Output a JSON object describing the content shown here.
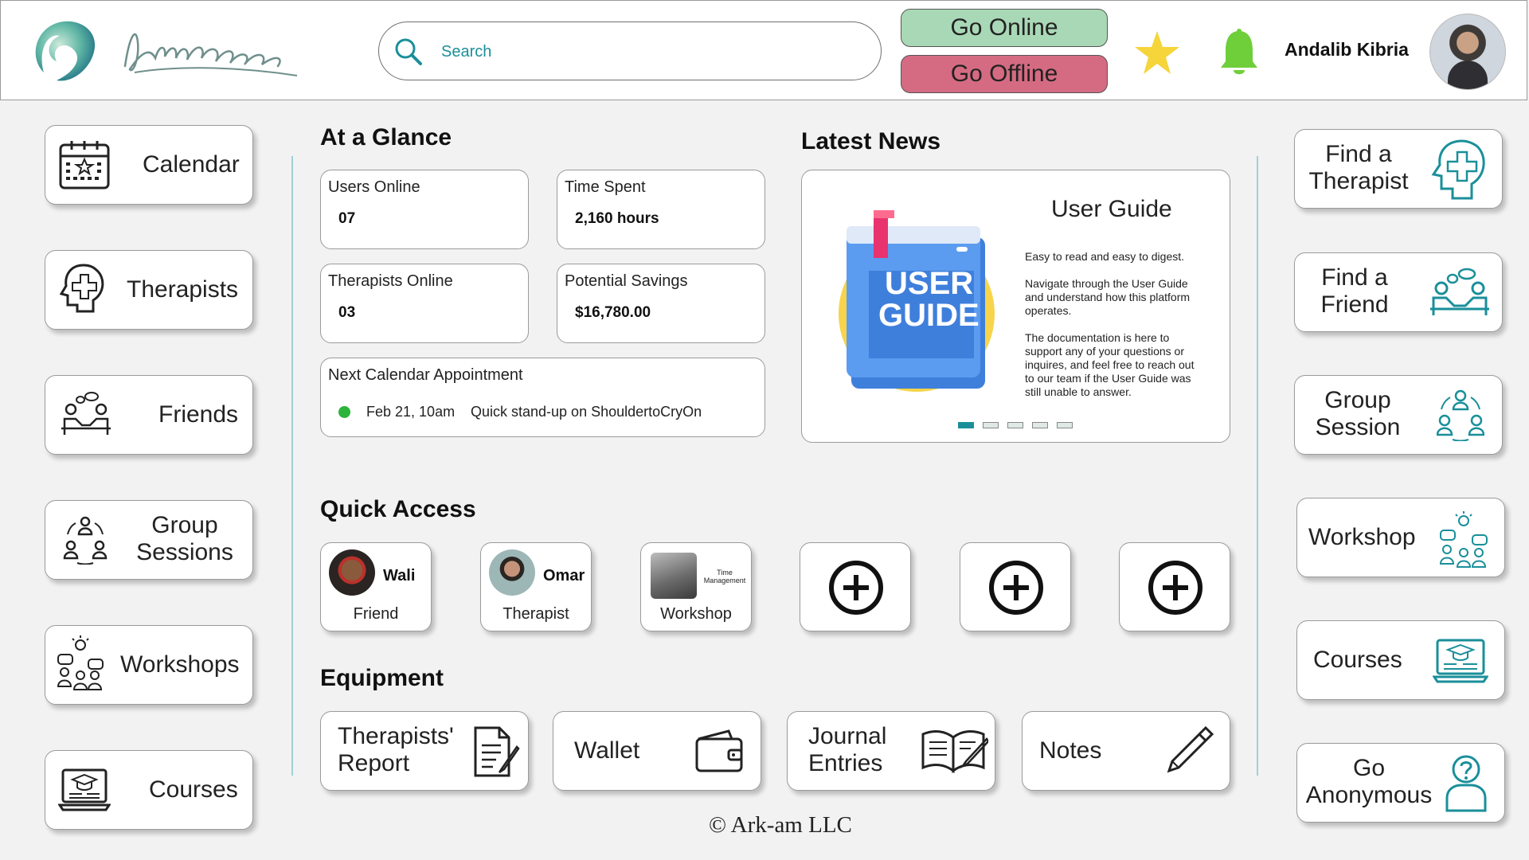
{
  "header": {
    "search_placeholder": "Search",
    "go_online": "Go Online",
    "go_offline": "Go Offline",
    "user_name": "Andalib Kibria"
  },
  "left_nav": [
    {
      "label": "Calendar",
      "icon": "calendar-icon"
    },
    {
      "label": "Therapists",
      "icon": "therapist-head-icon"
    },
    {
      "label": "Friends",
      "icon": "friends-icon"
    },
    {
      "label": "Group Sessions",
      "icon": "group-session-icon"
    },
    {
      "label": "Workshops",
      "icon": "workshop-icon"
    },
    {
      "label": "Courses",
      "icon": "courses-icon"
    }
  ],
  "glance": {
    "title": "At a Glance",
    "users_online_label": "Users Online",
    "users_online_value": "07",
    "time_spent_label": "Time Spent",
    "time_spent_value": "2,160 hours",
    "therapists_online_label": "Therapists Online",
    "therapists_online_value": "03",
    "savings_label": "Potential Savings",
    "savings_value": "$16,780.00",
    "appointment_label": "Next Calendar Appointment",
    "appointment_date": "Feb 21, 10am",
    "appointment_text": "Quick stand-up on ShouldertoCryOn"
  },
  "news": {
    "title": "Latest News",
    "card_title": "User Guide",
    "book_line1": "USER",
    "book_line2": "GUIDE",
    "p1": "Easy to read and easy to digest.",
    "p2": "Navigate through the User Guide and understand how this platform operates.",
    "p3": "The documentation is here to support any of your questions or inquires, and feel free to reach out to our team if the User Guide was still unable to answer."
  },
  "quick_access": {
    "title": "Quick Access",
    "items": [
      {
        "name": "Wali",
        "role": "Friend"
      },
      {
        "name": "Omar",
        "role": "Therapist"
      },
      {
        "name": "Time Management",
        "role": "Workshop"
      }
    ]
  },
  "equipment": {
    "title": "Equipment",
    "items": [
      {
        "label": "Therapists' Report",
        "icon": "report-icon"
      },
      {
        "label": "Wallet",
        "icon": "wallet-icon"
      },
      {
        "label": "Journal Entries",
        "icon": "journal-icon"
      },
      {
        "label": "Notes",
        "icon": "pen-icon"
      }
    ]
  },
  "right_nav": [
    {
      "label": "Find a Therapist",
      "icon": "therapist-head-icon"
    },
    {
      "label": "Find a Friend",
      "icon": "friends-icon"
    },
    {
      "label": "Group Session",
      "icon": "group-session-icon"
    },
    {
      "label": "Workshop",
      "icon": "workshop-icon"
    },
    {
      "label": "Courses",
      "icon": "courses-icon"
    },
    {
      "label": "Go Anonymous",
      "icon": "anonymous-user-icon"
    }
  ],
  "footer": "© Ark-am LLC",
  "colors": {
    "accent": "#1a8f9a",
    "online": "#a9d8b6",
    "offline": "#d46b82",
    "bell": "#6fcf3a",
    "star": "#f5d53a"
  }
}
